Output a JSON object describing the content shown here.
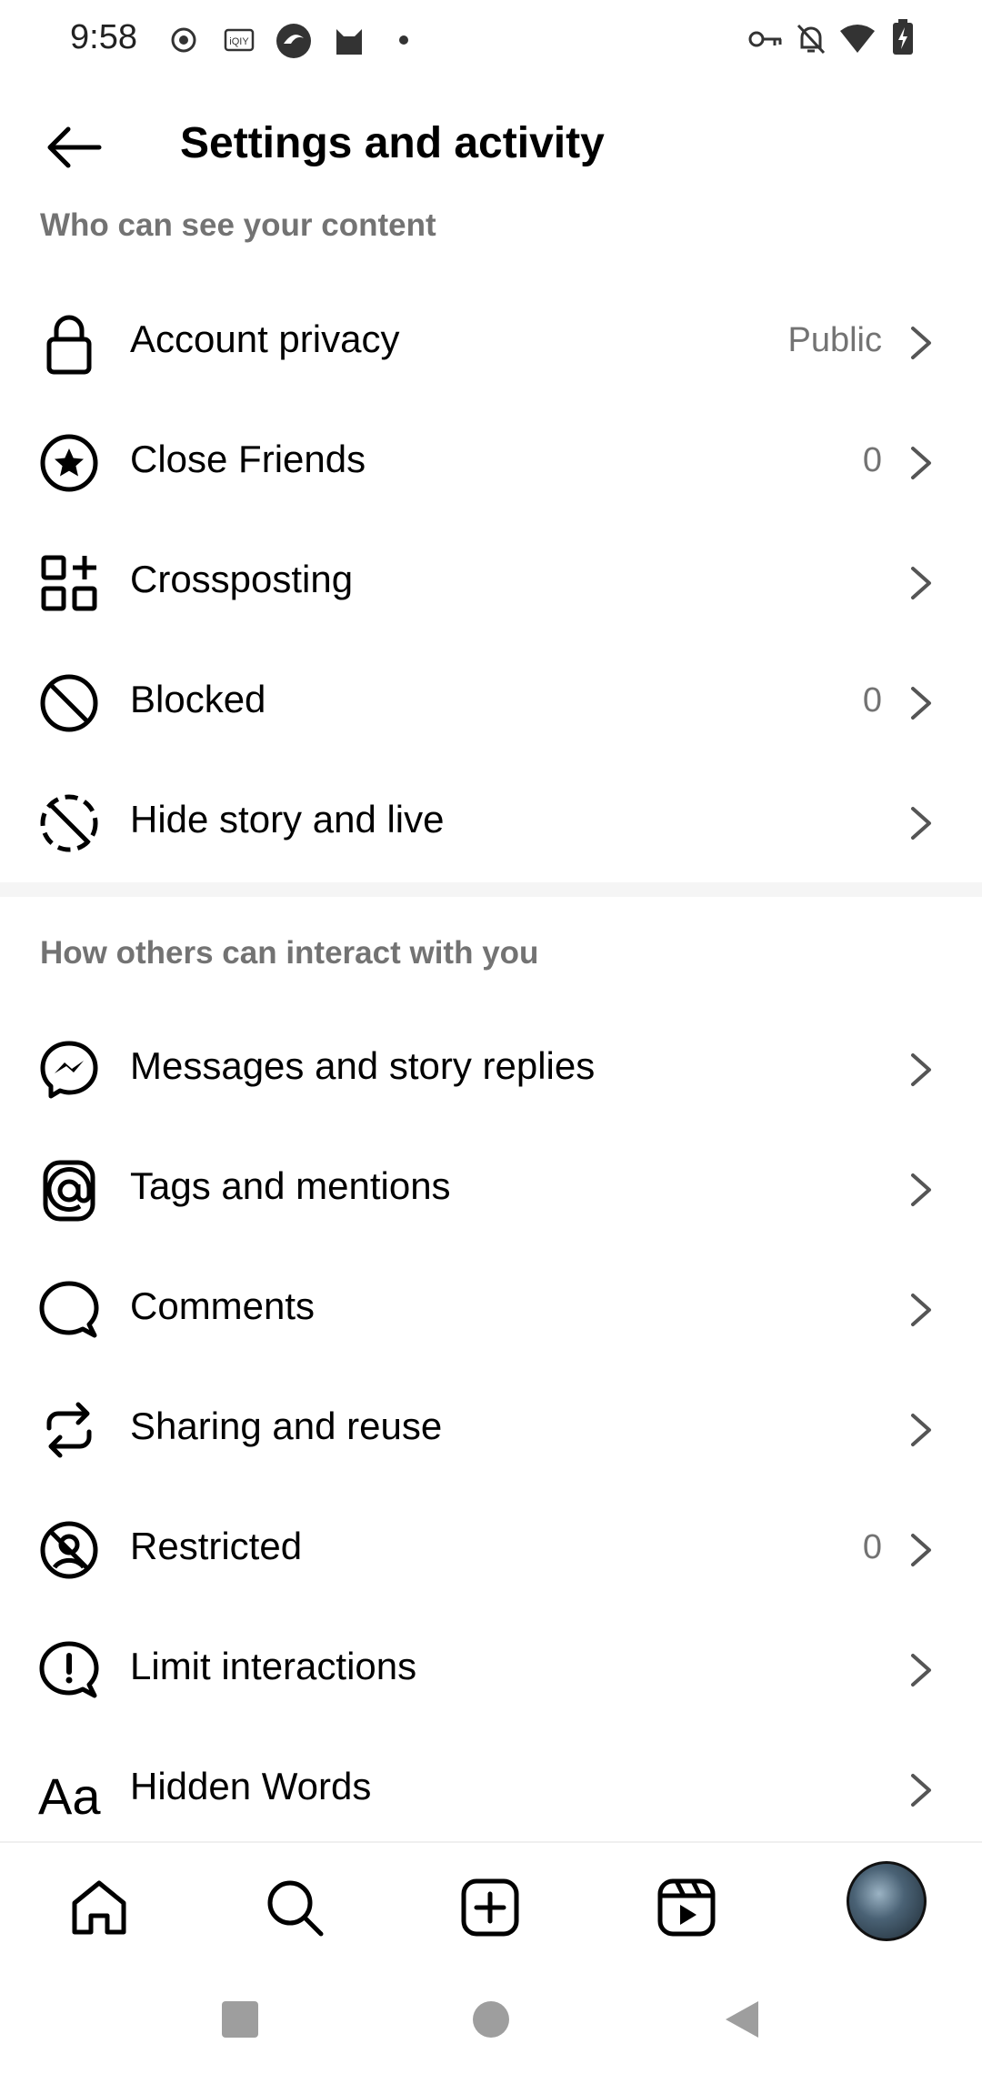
{
  "status_bar": {
    "time": "9:58",
    "left_icons": [
      "record-icon",
      "iqiyi-icon",
      "browser-icon",
      "cat-icon",
      "dot-icon"
    ],
    "right_icons": [
      "key-icon",
      "bell-muted-icon",
      "wifi-icon",
      "battery-charging-icon"
    ]
  },
  "header": {
    "title": "Settings and activity",
    "back_icon": "arrow-left-icon"
  },
  "sections": [
    {
      "label": "Who can see your content",
      "items": [
        {
          "label": "Account privacy",
          "value": "Public",
          "icon": "lock-icon"
        },
        {
          "label": "Close Friends",
          "value": "0",
          "icon": "star-circle-icon"
        },
        {
          "label": "Crossposting",
          "value": "",
          "icon": "grid-plus-icon"
        },
        {
          "label": "Blocked",
          "value": "0",
          "icon": "block-icon"
        },
        {
          "label": "Hide story and live",
          "value": "",
          "icon": "story-hidden-icon"
        }
      ]
    },
    {
      "label": "How others can interact with you",
      "items": [
        {
          "label": "Messages and story replies",
          "value": "",
          "icon": "messenger-icon"
        },
        {
          "label": "Tags and mentions",
          "value": "",
          "icon": "at-icon"
        },
        {
          "label": "Comments",
          "value": "",
          "icon": "comment-icon"
        },
        {
          "label": "Sharing and reuse",
          "value": "",
          "icon": "repost-icon"
        },
        {
          "label": "Restricted",
          "value": "0",
          "icon": "restricted-icon"
        },
        {
          "label": "Limit interactions",
          "value": "",
          "icon": "alert-bubble-icon"
        },
        {
          "label": "Hidden Words",
          "value": "",
          "icon": "text-aa-icon"
        }
      ]
    }
  ],
  "bottom_nav": [
    "home-icon",
    "search-icon",
    "create-icon",
    "reels-icon",
    "profile-avatar"
  ],
  "system_nav": [
    "recents-icon",
    "home-circle-icon",
    "back-triangle-icon"
  ]
}
